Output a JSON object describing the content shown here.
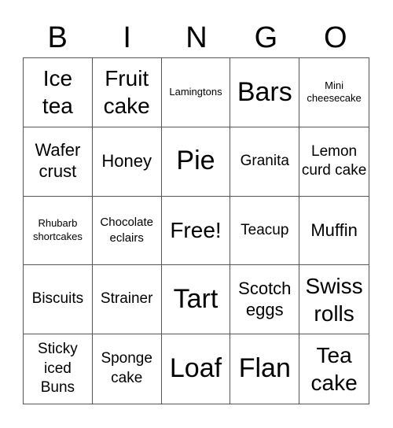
{
  "title_letters": [
    "B",
    "I",
    "N",
    "G",
    "O"
  ],
  "cells": [
    {
      "text": "Ice tea",
      "size": "s-l"
    },
    {
      "text": "Fruit cake",
      "size": "s-l"
    },
    {
      "text": "Lamingtons",
      "size": "s-xs"
    },
    {
      "text": "Bars",
      "size": "s-xl"
    },
    {
      "text": "Mini cheesecake",
      "size": "s-xs"
    },
    {
      "text": "Wafer crust",
      "size": "s-m"
    },
    {
      "text": "Honey",
      "size": "s-m"
    },
    {
      "text": "Pie",
      "size": "s-xl"
    },
    {
      "text": "Granita",
      "size": "s-ms"
    },
    {
      "text": "Lemon curd cake",
      "size": "s-ms"
    },
    {
      "text": "Rhubarb shortcakes",
      "size": "s-xs"
    },
    {
      "text": "Chocolate eclairs",
      "size": "s-s"
    },
    {
      "text": "Free!",
      "size": "s-l"
    },
    {
      "text": "Teacup",
      "size": "s-ms"
    },
    {
      "text": "Muffin",
      "size": "s-m"
    },
    {
      "text": "Biscuits",
      "size": "s-ms"
    },
    {
      "text": "Strainer",
      "size": "s-ms"
    },
    {
      "text": "Tart",
      "size": "s-xl"
    },
    {
      "text": "Scotch eggs",
      "size": "s-m"
    },
    {
      "text": "Swiss rolls",
      "size": "s-l"
    },
    {
      "text": "Sticky iced Buns",
      "size": "s-ms"
    },
    {
      "text": "Sponge cake",
      "size": "s-ms"
    },
    {
      "text": "Loaf",
      "size": "s-xl"
    },
    {
      "text": "Flan",
      "size": "s-xl"
    },
    {
      "text": "Tea cake",
      "size": "s-l"
    }
  ]
}
